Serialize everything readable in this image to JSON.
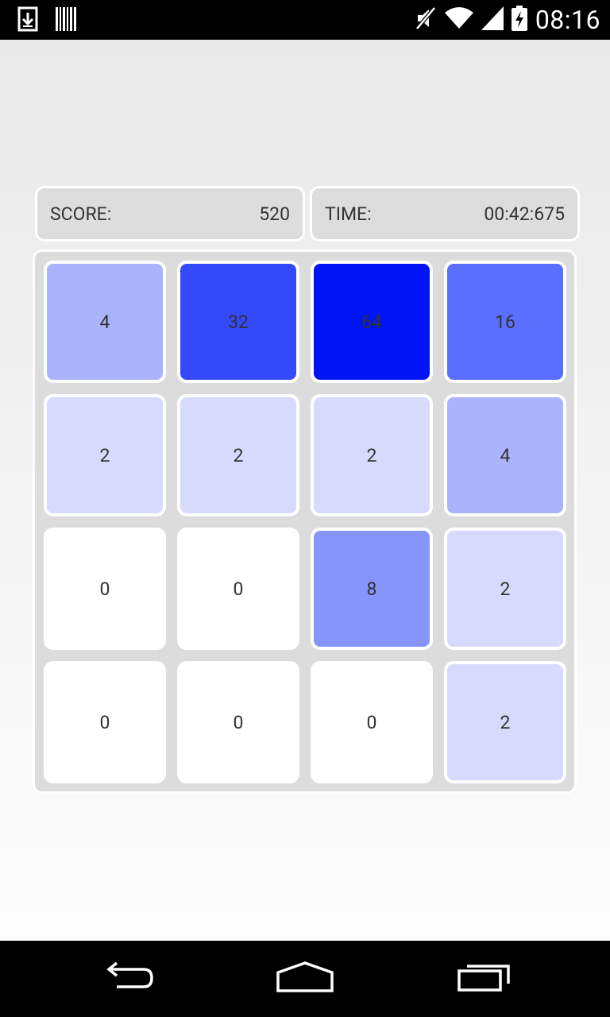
{
  "status_bar": {
    "time": "08:16",
    "icons": [
      "download-icon",
      "barcode-icon",
      "mute-icon",
      "wifi-icon",
      "signal-icon",
      "battery-charging-icon"
    ]
  },
  "score": {
    "label": "SCORE:",
    "value": "520"
  },
  "time": {
    "label": "TIME:",
    "value": "00:42:675"
  },
  "board": {
    "rows": [
      [
        {
          "value": "4",
          "color": "#aab4fd"
        },
        {
          "value": "32",
          "color": "#3349fa"
        },
        {
          "value": "64",
          "color": "#0014f5"
        },
        {
          "value": "16",
          "color": "#5a6ffd"
        }
      ],
      [
        {
          "value": "2",
          "color": "#d6dbfd"
        },
        {
          "value": "2",
          "color": "#d6dbfd"
        },
        {
          "value": "2",
          "color": "#d6dbfd"
        },
        {
          "value": "4",
          "color": "#aab4fd"
        }
      ],
      [
        {
          "value": "0",
          "color": "#ffffff"
        },
        {
          "value": "0",
          "color": "#ffffff"
        },
        {
          "value": "8",
          "color": "#8694fb"
        },
        {
          "value": "2",
          "color": "#d6dbfd"
        }
      ],
      [
        {
          "value": "0",
          "color": "#ffffff"
        },
        {
          "value": "0",
          "color": "#ffffff"
        },
        {
          "value": "0",
          "color": "#ffffff"
        },
        {
          "value": "2",
          "color": "#d6dbfd"
        }
      ]
    ]
  },
  "nav_bar": {
    "buttons": [
      "back-icon",
      "home-icon",
      "recent-apps-icon"
    ]
  }
}
